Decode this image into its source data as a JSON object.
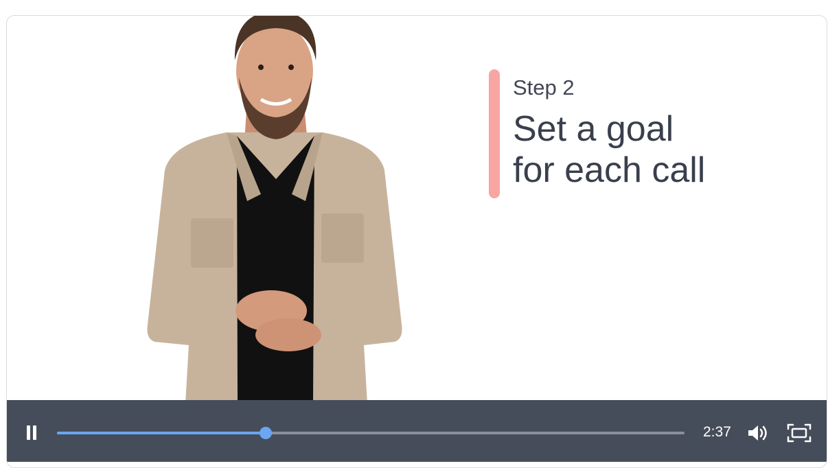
{
  "video": {
    "step_label": "Step 2",
    "title_line1": "Set a goal",
    "title_line2": "for each call",
    "progress": 0.333
  },
  "controls": {
    "pause_icon": "pause-icon",
    "time": "2:37",
    "volume_icon": "volume-icon",
    "fullscreen_icon": "fullscreen-icon"
  },
  "colors": {
    "accent_bar": "#f7a6a3",
    "progress_fill": "#6aa6f2",
    "progress_handle": "#6aa6f2",
    "control_bar": "#464d5a"
  }
}
